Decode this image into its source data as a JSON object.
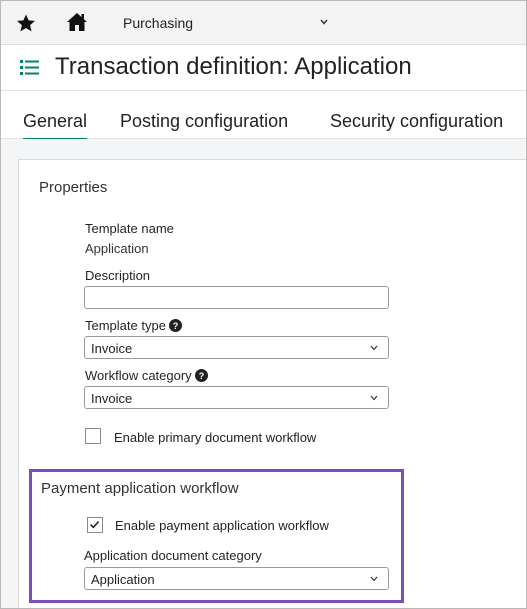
{
  "nav": {
    "module": "Purchasing"
  },
  "header": {
    "title": "Transaction definition: Application"
  },
  "tabs": [
    {
      "label": "General",
      "active": true
    },
    {
      "label": "Posting configuration",
      "active": false
    },
    {
      "label": "Security configuration",
      "active": false
    }
  ],
  "properties": {
    "section_title": "Properties",
    "template_name_label": "Template name",
    "template_name_value": "Application",
    "description_label": "Description",
    "description_value": "",
    "template_type_label": "Template type",
    "template_type_value": "Invoice",
    "workflow_category_label": "Workflow category",
    "workflow_category_value": "Invoice",
    "enable_primary_label": "Enable primary document workflow",
    "enable_primary_checked": false
  },
  "payment_workflow": {
    "section_title": "Payment application workflow",
    "enable_label": "Enable payment application workflow",
    "enable_checked": true,
    "doc_category_label": "Application document category",
    "doc_category_value": "Application"
  },
  "colors": {
    "accent": "#00856a",
    "highlight": "#7a4fb6"
  }
}
